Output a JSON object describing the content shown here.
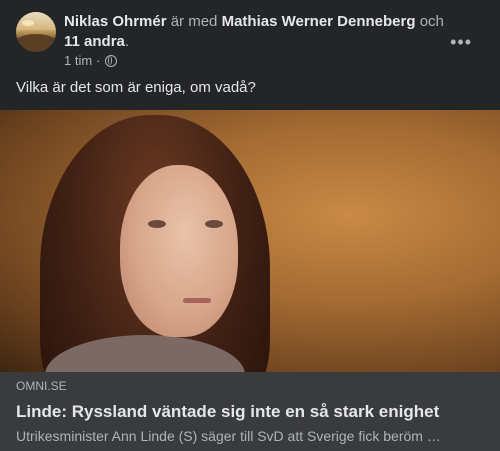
{
  "post": {
    "author": "Niklas Ohrmér",
    "with_text": "är med",
    "tagged_person": "Mathias Werner Denneberg",
    "and_text": "och",
    "others": "11 andra",
    "period": ".",
    "time": "1 tim",
    "dot": "·",
    "privacy_icon": "globe-icon",
    "more_icon": "more-options-icon",
    "more_glyph": "•••",
    "message": "Vilka är det som är eniga, om vadå?"
  },
  "link_preview": {
    "domain": "OMNI.SE",
    "headline": "Linde: Ryssland väntade sig inte en så stark enighet",
    "description": "Utrikesminister Ann Linde (S) säger till SvD att Sverige fick beröm …"
  },
  "colors": {
    "card_bg": "#242526",
    "link_bg": "#3a3b3c",
    "primary_text": "#e4e6eb",
    "secondary_text": "#b0b3b8"
  }
}
